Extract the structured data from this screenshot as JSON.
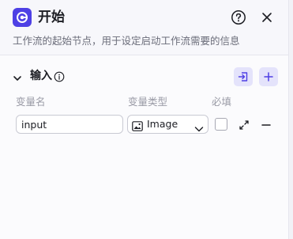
{
  "header": {
    "title": "开始",
    "description": "工作流的起始节点，用于设定启动工作流需要的信息"
  },
  "input_section": {
    "title": "输入",
    "columns": [
      "变量名",
      "变量类型",
      "必填"
    ],
    "rows": [
      {
        "name": "input",
        "type": "Image",
        "required": false
      }
    ]
  },
  "icons": {
    "node": "start-node-icon",
    "help": "question-circle-icon",
    "close": "close-icon",
    "collapse": "chevron-down-icon",
    "info": "info-icon",
    "import": "import-icon",
    "add": "plus-icon",
    "type": "image-icon",
    "expand": "expand-arrows-icon",
    "remove": "minus-icon"
  },
  "colors": {
    "accent": "#4e40e5",
    "accent_light": "#e4e3fb"
  }
}
